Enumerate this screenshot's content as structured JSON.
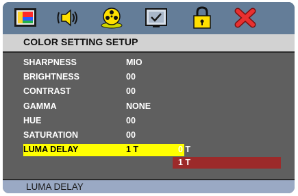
{
  "icons": [
    "picture-icon",
    "sound-icon",
    "film-reel-icon",
    "check-screen-icon",
    "lock-icon",
    "close-icon"
  ],
  "menu_title": "COLOR SETTING SETUP",
  "settings": [
    {
      "label": "SHARPNESS",
      "value": "MIO"
    },
    {
      "label": "BRIGHTNESS",
      "value": "00"
    },
    {
      "label": "CONTRAST",
      "value": "00"
    },
    {
      "label": "GAMMA",
      "value": "NONE"
    },
    {
      "label": "HUE",
      "value": "00"
    },
    {
      "label": "SATURATION",
      "value": "00"
    },
    {
      "label": "LUMA DELAY",
      "value": "1 T"
    }
  ],
  "options": [
    "0 T",
    "1 T"
  ],
  "status_text": "LUMA DELAY",
  "colors": {
    "icon_bar": "#647d98",
    "panel": "#5f5f5f",
    "selected_row": "#ffff00",
    "selected_option": "#9c2a2a",
    "status_bar": "#9aa9c4"
  }
}
